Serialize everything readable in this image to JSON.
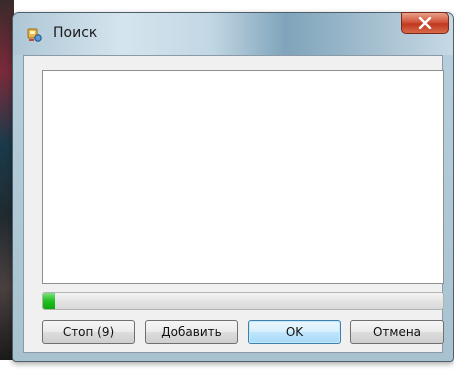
{
  "window": {
    "title": "Поиск",
    "icon": "search-app-icon"
  },
  "titlebar": {
    "close_icon": "close-icon",
    "close_color": "#c7412a"
  },
  "results": {
    "items": []
  },
  "progress": {
    "value": 0.03,
    "color": "#1fbf1f"
  },
  "buttons": {
    "stop_label": "Стоп (9)",
    "add_label": "Добавить",
    "ok_label": "OK",
    "cancel_label": "Отмена"
  }
}
